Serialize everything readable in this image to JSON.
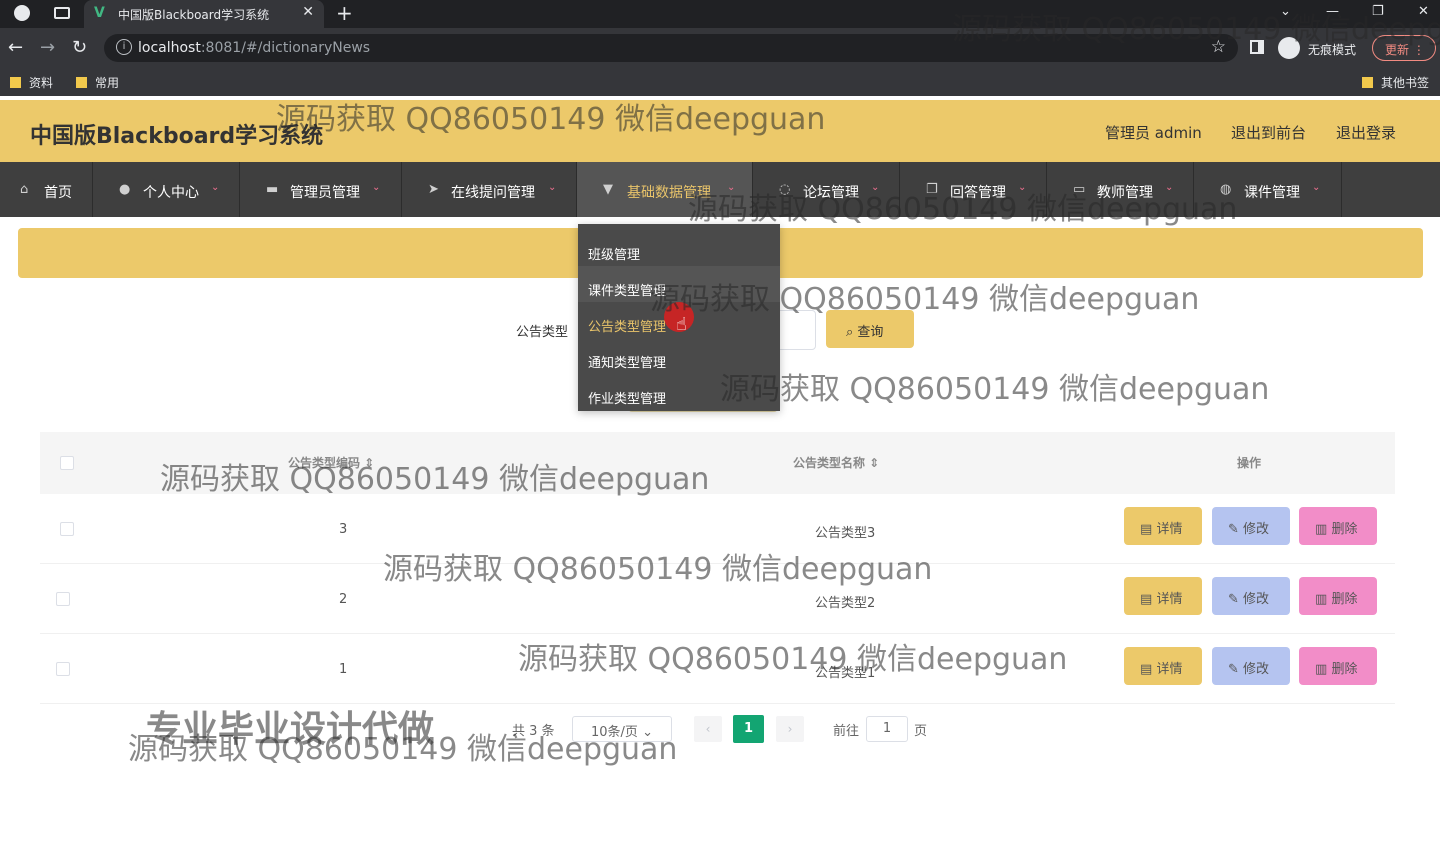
{
  "browser": {
    "tab_title": "中国版Blackboard学习系统",
    "tab_favicon": "V",
    "url_host": "localhost",
    "url_rest": ":8081/#/dictionaryNews",
    "incognito_label": "无痕模式",
    "update_label": "更新",
    "bookmarks": [
      "资料",
      "常用"
    ],
    "other_bookmarks": "其他书签"
  },
  "header": {
    "title": "中国版Blackboard学习系统",
    "user": "管理员 admin",
    "to_front": "退出到前台",
    "logout": "退出登录",
    "accent_color": "#ecc96a"
  },
  "nav": {
    "items": [
      {
        "label": "首页",
        "icon": "home-icon"
      },
      {
        "label": "个人中心",
        "icon": "user-icon"
      },
      {
        "label": "管理员管理",
        "icon": "folder-icon"
      },
      {
        "label": "在线提问管理",
        "icon": "send-icon"
      },
      {
        "label": "基础数据管理",
        "icon": "filter-icon"
      },
      {
        "label": "论坛管理",
        "icon": "chat-icon"
      },
      {
        "label": "回答管理",
        "icon": "copy-icon"
      },
      {
        "label": "教师管理",
        "icon": "monitor-icon"
      },
      {
        "label": "课件管理",
        "icon": "globe-icon"
      }
    ]
  },
  "dropdown": {
    "items": [
      "班级管理",
      "课件类型管理",
      "公告类型管理",
      "通知类型管理",
      "作业类型管理"
    ]
  },
  "search": {
    "label": "公告类型",
    "button": "查询"
  },
  "table": {
    "columns": [
      "公告类型编码",
      "公告类型名称",
      "操作"
    ],
    "rows": [
      {
        "code": "3",
        "name": "公告类型3"
      },
      {
        "code": "2",
        "name": "公告类型2"
      },
      {
        "code": "1",
        "name": "公告类型1"
      }
    ],
    "actions": {
      "detail": "详情",
      "edit": "修改",
      "delete": "删除"
    }
  },
  "pagination": {
    "total": "共 3 条",
    "page_size": "10条/页",
    "current": "1",
    "goto_label": "前往",
    "goto_value": "1",
    "page_unit": "页"
  },
  "watermark": {
    "text": "源码获取 QQ86050149 微信deepguan",
    "big_text": "专业毕业设计代做"
  }
}
